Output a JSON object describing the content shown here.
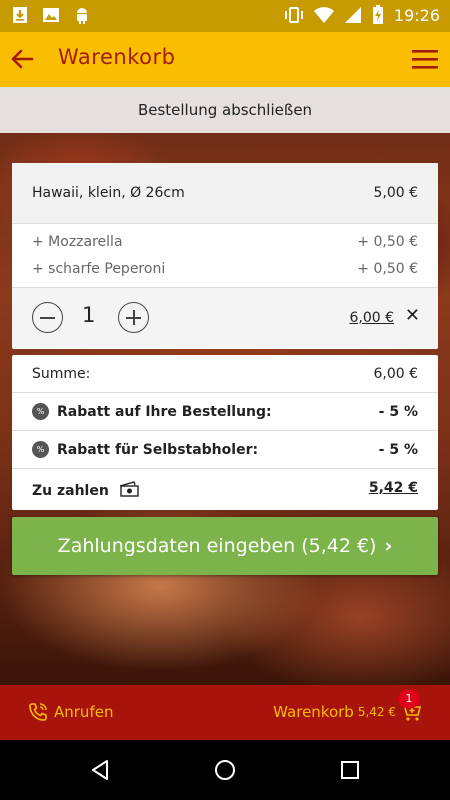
{
  "status_bar": {
    "time": "19:26",
    "left_icons": [
      "download-icon",
      "image-icon",
      "android-icon"
    ],
    "right_icons": [
      "vibrate-icon",
      "wifi-icon",
      "signal-icon",
      "battery-charging-icon"
    ]
  },
  "app_bar": {
    "title": "Warenkorb",
    "back_icon": "arrow-left-icon",
    "menu_icon": "hamburger-menu-icon",
    "color": "#fbbd00",
    "title_color": "#a11d05"
  },
  "subheader": {
    "title": "Bestellung abschließen"
  },
  "cart_item": {
    "name": "Hawaii, klein, Ø 26cm",
    "price": "5,00 €",
    "extras": [
      {
        "label": "+ Mozzarella",
        "price": "+ 0,50 €"
      },
      {
        "label": "+ scharfe Peperoni",
        "price": "+ 0,50 €"
      }
    ],
    "quantity": "1",
    "total": "6,00 €",
    "remove_symbol": "✕"
  },
  "summary": {
    "sum_label": "Summe:",
    "sum_value": "6,00 €",
    "discount_icon": "percent-badge-icon",
    "discount_symbol": "%",
    "discounts": [
      {
        "label": "Rabatt auf Ihre Bestellung:",
        "value": "- 5 %"
      },
      {
        "label": "Rabatt für Selbstabholer:",
        "value": "- 5 %"
      }
    ],
    "total_label": "Zu zahlen",
    "total_value": "5,42 €"
  },
  "pay_button": {
    "label": "Zahlungsdaten eingeben (5,42 €)",
    "color": "#7cb34a"
  },
  "bottom_bar": {
    "call_label": "Anrufen",
    "cart_label": "Warenkorb",
    "cart_amount": "5,42 €",
    "cart_badge": "1",
    "color": "#a8130b",
    "text_color": "#fbbd00"
  },
  "nav_bar": {
    "icons": [
      "back-triangle-icon",
      "home-circle-icon",
      "recents-square-icon"
    ]
  }
}
